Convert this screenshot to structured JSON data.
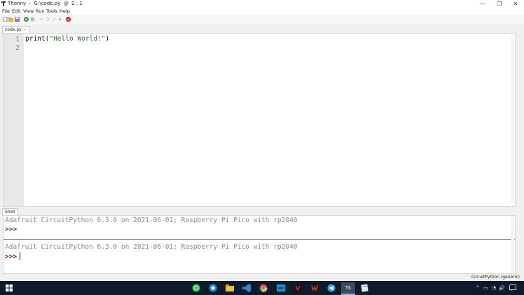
{
  "window": {
    "title": "Thonny  -  G:\\code.py  @  2 : 1",
    "minimize": "—",
    "restore": "❐",
    "close": "✕"
  },
  "menu": [
    "File",
    "Edit",
    "View",
    "Run",
    "Tools",
    "Help"
  ],
  "toolbar_icons": [
    "new-file-icon",
    "open-file-icon",
    "save-icon",
    "run-icon",
    "debug-icon",
    "step-over-icon",
    "step-into-icon",
    "step-out-icon",
    "resume-icon",
    "stop-icon"
  ],
  "editor": {
    "tab_label": "code.py",
    "tab_close": "×",
    "line_numbers": [
      "1",
      "2"
    ],
    "code_func": "print",
    "code_open": "(",
    "code_string": "\"Hello World!\"",
    "code_close": ")"
  },
  "shell": {
    "tab_label": "Shell",
    "banner_1": "Adafruit CircuitPython 6.3.0 on 2021-06-01; Raspberry Pi Pico with rp2040",
    "prompt_1": ">>>",
    "banner_2": "Adafruit CircuitPython 6.3.0 on 2021-06-01; Raspberry Pi Pico with rp2040",
    "prompt_2": ">>>"
  },
  "status": {
    "interpreter": "CircuitPython (generic)"
  },
  "taskbar": {
    "apps": [
      "whatsapp-icon",
      "skype-icon",
      "file-explorer-icon",
      "vscode-icon",
      "chrome-icon",
      "app-blue-icon",
      "app-red-icon",
      "app-brave-icon",
      "telegram-icon",
      "thonny-icon",
      "app-notes-icon"
    ],
    "thonny_label": "Tk",
    "tray": [
      "^",
      "▭",
      "◔",
      "🔊"
    ]
  },
  "colors": {
    "accent_string": "#2a7a2a",
    "prompt": "#7a1a7a",
    "taskbar": "#0f1a2b"
  }
}
